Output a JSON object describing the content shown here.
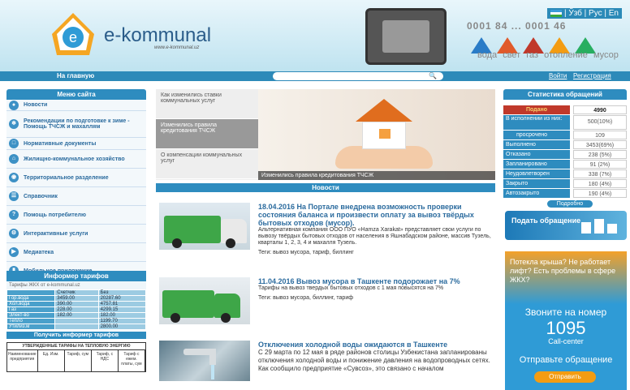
{
  "header": {
    "logo_text": "e-kommunal",
    "logo_sub": "www.e-kommunal.uz",
    "lang": "| Ўзб | Рус | En",
    "counters": "0001 84 ... 0001 46",
    "utilities": [
      "вода",
      "свет",
      "газ",
      "отопление",
      "мусор"
    ]
  },
  "nav": {
    "home": "На главную",
    "search_placeholder": "",
    "login": "Войти",
    "register": "Регистрация"
  },
  "menu": {
    "title": "Меню сайта",
    "items": [
      "Новости",
      "Рекомендации по подготовке к зиме - Помощь ТЧСЖ и махаллям",
      "Нормативные документы",
      "Жилищно-коммунальное хозяйство",
      "Территориальное разделение",
      "Справочник",
      "Помощь потребителю",
      "Интерактивные услуги",
      "Медиатека",
      "Мобильное приложение"
    ]
  },
  "informer": {
    "title": "Информер тарифов",
    "subtitle": "Тарифы ЖКХ от e-kommunal.uz",
    "headers": [
      "",
      "Счетчик",
      "Без"
    ],
    "rows": [
      [
        "Гор.вода",
        "3459.00",
        "20287.60"
      ],
      [
        "Хол.вода",
        "390.00",
        "4757.81"
      ],
      [
        "Газ",
        "228.00",
        "4299.15"
      ],
      [
        "Элект-во",
        "182.00",
        "182.00"
      ],
      [
        "Тепло",
        "",
        "1199.70"
      ],
      [
        "Утилиз.м",
        "",
        "2800.00"
      ]
    ],
    "button": "Получить информер тарифов",
    "mini_caption": "УТВЕРЖДЕННЫЕ ТАРИФЫ НА ТЕПЛОВУЮ ЭНЕРГИЮ",
    "mini_cols": [
      "Наименование предприятия",
      "Ед. Изм.",
      "Тариф, сум",
      "Тариф, с НДС",
      "Тариф с ежем. платы, сум"
    ]
  },
  "slider": {
    "tabs": [
      "Как изменились ставки коммунальных услуг",
      "Изменились правила кредитования ТЧСЖ",
      "О компенсации коммунальных услуг"
    ],
    "caption": "Изменились правила кредитования ТЧСЖ"
  },
  "news": {
    "title": "Новости",
    "items": [
      {
        "head": "18.04.2016 На Портале внедрена возможность проверки состояния баланса и произвести оплату за вывоз твёрдых бытовых отходов (мусор).",
        "text": "Альтернативная компания ООО ПУО «Hamza Xarakat» представляет свои услуги по вывозу твёрдых бытовых отходов от населения в Яшнабадском районе, массив Тузель, кварталы 1, 2, 3, 4 и махалля Тузель.",
        "tags": "Теги:  вывоз мусора,  тариф,  биллинг"
      },
      {
        "head": "11.04.2016 Вывоз мусора в Ташкенте подорожает на 7%",
        "text": "Тарифы на вывоз твердых бытовых отходов с 1 мая повысятся на 7%",
        "tags": "Теги:  вывоз мусора,  биллинг,  тариф"
      },
      {
        "head": "Отключения холодной воды ожидаются в Ташкенте",
        "text": "С 29 марта по 12 мая в ряде районов столицы Узбекистана запланированы отключения холодной воды и понижение давления на водопроводных сетях. Как сообщило предприятие «Сувсоз», это связано с началом",
        "tags": ""
      }
    ]
  },
  "stats": {
    "title": "Статистика обращений",
    "rows": [
      {
        "label": "Подано",
        "value": "4990"
      },
      {
        "label": "В исполнении из них:",
        "value": "500(10%)"
      },
      {
        "label": "просрочено",
        "value": "109"
      },
      {
        "label": "Выполнено",
        "value": "3453(69%)"
      },
      {
        "label": "Отказано",
        "value": "238 (5%)"
      },
      {
        "label": "Запланировано",
        "value": "91 (2%)"
      },
      {
        "label": "Неудовлетворен",
        "value": "338 (7%)"
      },
      {
        "label": "Закрыто",
        "value": "180 (4%)"
      },
      {
        "label": "Автозакрыто",
        "value": "190 (4%)"
      }
    ],
    "more": "Подробно"
  },
  "submit": {
    "text": "Подать обращение"
  },
  "ad": {
    "question": "Потекла крыша? Не работает лифт? Есть проблемы в сфере ЖКХ?",
    "call": "Звоните на номер",
    "number": "1095",
    "callcenter": "Call-center",
    "send": "Отправьте обращение",
    "button": "Отправить"
  },
  "colors": {
    "primary": "#2e8cbf",
    "accent": "#f39c12",
    "danger": "#c0392b"
  }
}
